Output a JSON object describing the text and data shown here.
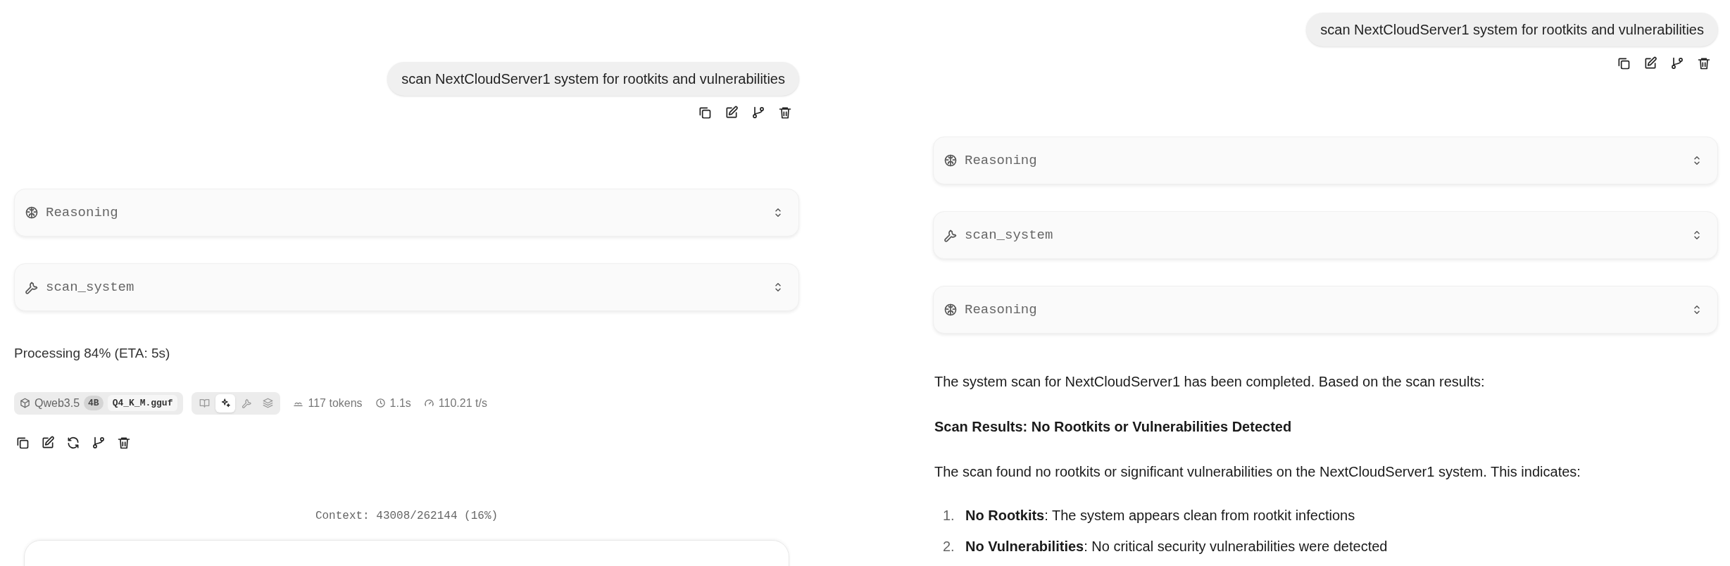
{
  "panels": [
    {
      "user_message": "scan NextCloudServer1 system for rootkits and vulnerabilities",
      "blocks": [
        {
          "kind": "reasoning",
          "label": "Reasoning"
        },
        {
          "kind": "tool",
          "label": "scan_system"
        }
      ],
      "processing": "Processing 84% (ETA: 5s)",
      "model": {
        "name": "Qweb3.5",
        "size": "4B",
        "file": "Q4_K_M.gguf"
      },
      "modes": [
        {
          "kind": "book",
          "selected": false
        },
        {
          "kind": "sparkles",
          "selected": true
        },
        {
          "kind": "wrench",
          "selected": false
        },
        {
          "kind": "layers",
          "selected": false
        }
      ],
      "stats": [
        {
          "kind": "tokens",
          "text": "117 tokens"
        },
        {
          "kind": "time",
          "text": "1.1s"
        },
        {
          "kind": "speed",
          "text": "110.21 t/s"
        }
      ],
      "context": "Context: 43008/262144 (16%)"
    },
    {
      "user_message": "scan NextCloudServer1 system for rootkits and vulnerabilities",
      "blocks": [
        {
          "kind": "reasoning",
          "label": "Reasoning"
        },
        {
          "kind": "tool",
          "label": "scan_system"
        },
        {
          "kind": "reasoning",
          "label": "Reasoning"
        }
      ],
      "response": [
        {
          "kind": "paragraph",
          "text": "The system scan for NextCloudServer1 has been completed. Based on the scan results:"
        },
        {
          "kind": "heading",
          "text": "Scan Results: No Rootkits or Vulnerabilities Detected"
        },
        {
          "kind": "paragraph",
          "text": "The scan found no rootkits or significant vulnerabilities on the NextCloudServer1 system. This indicates:"
        },
        {
          "kind": "list",
          "items": [
            {
              "marker": "1.",
              "text": "**No Rootkits**: The system appears clean from rootkit infections"
            },
            {
              "marker": "2.",
              "text": "**No Vulnerabilities**: No critical security vulnerabilities were detected"
            }
          ]
        }
      ]
    }
  ]
}
